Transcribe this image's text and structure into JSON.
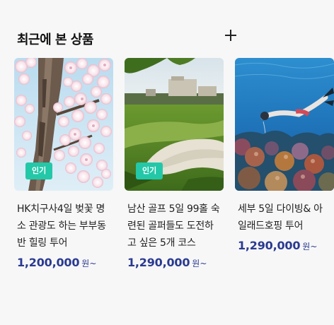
{
  "section": {
    "title": "최근에 본 상품",
    "add_icon": "plus-icon"
  },
  "products": [
    {
      "badge": "인기",
      "title": "HK치구사4일 벚꽃 명소 관광도 하는 부부동반 힐링 투어",
      "price": "1,200,000",
      "price_unit": "원~",
      "image": "cherry-blossom-photo"
    },
    {
      "badge": "인기",
      "title": "남산 골프 5일 99홀 숙련된 골퍼들도 도전하고 싶은 5개 코스",
      "price": "1,290,000",
      "price_unit": "원~",
      "image": "golf-course-photo"
    },
    {
      "title": "세부 5일 다이빙& 아일래드호핑 투어",
      "price": "1,290,000",
      "price_unit": "원~",
      "image": "scuba-diving-photo"
    }
  ],
  "colors": {
    "badge": "#23c8a8",
    "price": "#2a3a8f",
    "background": "#f7f7f8"
  }
}
